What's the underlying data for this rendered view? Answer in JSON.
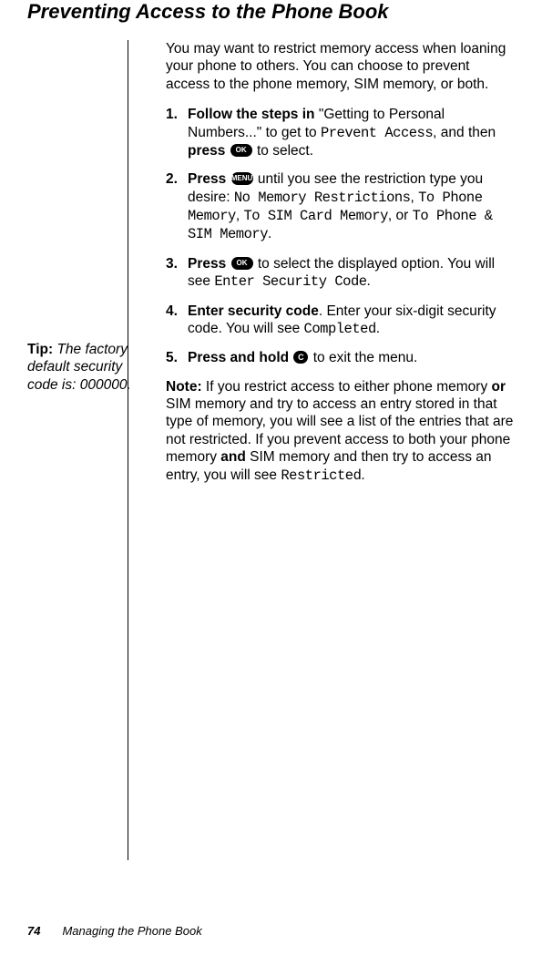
{
  "title": "Preventing Access to the Phone Book",
  "intro": "You may want to restrict memory access when loaning your phone to others. You can choose to prevent access to the phone memory, SIM memory, or both.",
  "steps": {
    "s1": {
      "num": "1.",
      "lead": "Follow the steps in ",
      "quote": "\"Getting to Personal Numbers...\" to get to ",
      "lcd1": "Prevent Access",
      "mid": ", and then ",
      "press": "press ",
      "ok": "OK",
      "tail": " to select."
    },
    "s2": {
      "num": "2.",
      "press": "Press ",
      "menu": "MENU",
      "mid": " until you see the restriction type you desire: ",
      "lcd1": "No Memory Restrictions",
      "c1": ", ",
      "lcd2": "To Phone Memory",
      "c2": ", ",
      "lcd3": "To SIM Card Memory",
      "c3": ", or ",
      "lcd4": "To Phone & SIM Memory",
      "c4": "."
    },
    "s3": {
      "num": "3.",
      "press": "Press ",
      "ok": "OK",
      "mid": " to select the displayed option. You will see ",
      "lcd1": "Enter Security Code",
      "tail": "."
    },
    "s4": {
      "num": "4.",
      "lead": "Enter security code",
      "mid": ". Enter your six-digit security code. You will see ",
      "lcd1": "Completed",
      "tail": "."
    },
    "s5": {
      "num": "5.",
      "lead": "Press and hold ",
      "c": "C",
      "tail": " to exit the menu."
    }
  },
  "note": {
    "label": "Note: ",
    "p1": "If you restrict access to either phone memory ",
    "or": "or",
    "p2": " SIM memory and try to access an entry stored in that type of memory, you will see a list of the entries that are not restricted. If you prevent access to both your phone memory ",
    "and": "and",
    "p3": " SIM memory and then try to access an entry, you will see ",
    "lcd": "Restricted",
    "tail": "."
  },
  "tip": {
    "label": "Tip: ",
    "body": "The factory default security code is: 000000."
  },
  "footer": {
    "page": "74",
    "chapter": "Managing the Phone Book"
  }
}
